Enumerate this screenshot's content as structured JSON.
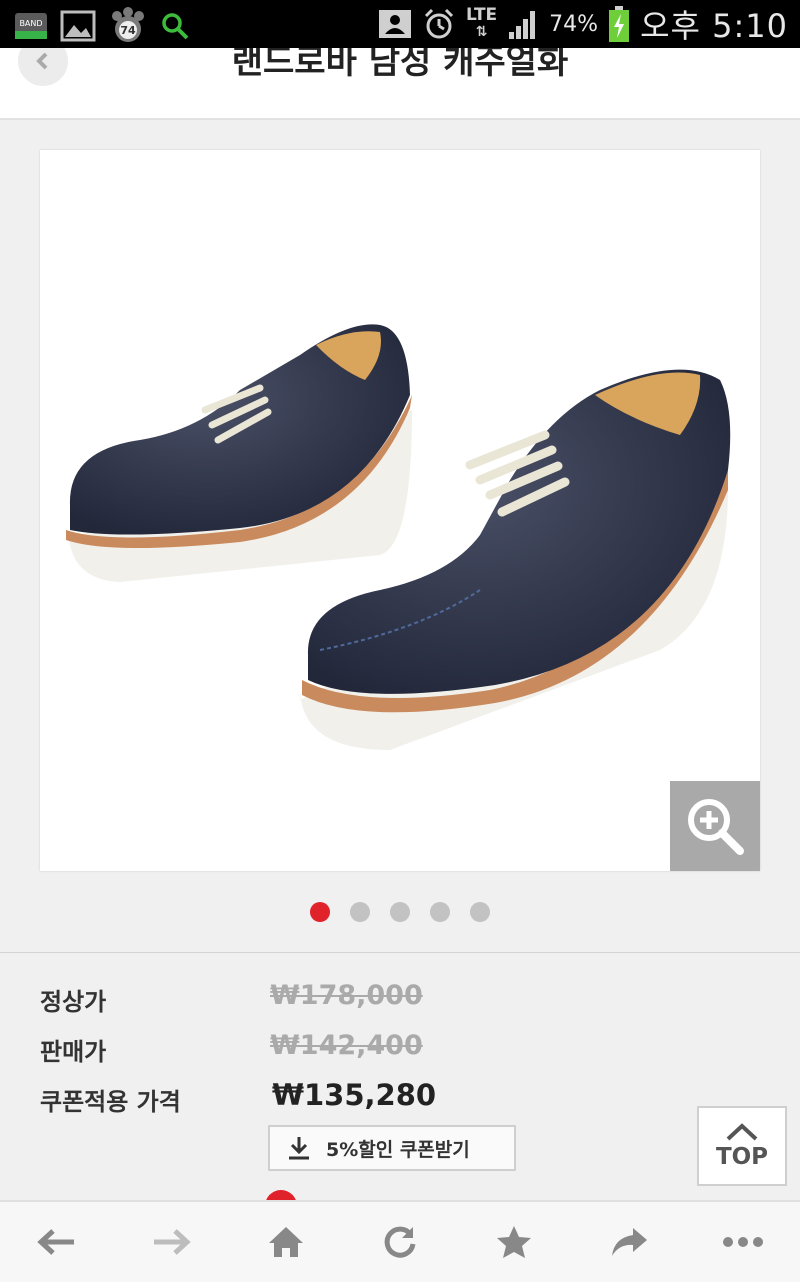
{
  "status_bar": {
    "clock": "오후 5:10",
    "battery_percent": "74%",
    "network": "LTE",
    "notification_badge": "74",
    "band_label": "BAND",
    "icons": [
      "band-icon",
      "gallery-icon",
      "paw-icon",
      "search-icon",
      "contact-icon",
      "alarm-icon",
      "lte-icon",
      "signal-icon",
      "battery-icon"
    ]
  },
  "header": {
    "title": "랜드로바 남성 캐주얼화",
    "back_icon": "chevron-left-icon"
  },
  "gallery": {
    "slide_count": 5,
    "active_index": 0,
    "zoom_icon": "zoom-in-icon"
  },
  "prices": {
    "regular_label": "정상가",
    "regular_value": "₩178,000",
    "sale_label": "판매가",
    "sale_value": "₩142,400",
    "coupon_label": "쿠폰적용 가격",
    "coupon_value": "₩135,280",
    "coupon_button": "5%할인 쿠폰받기"
  },
  "top_button": {
    "label": "TOP"
  },
  "bottom_nav": {
    "items": [
      "back-arrow-icon",
      "forward-arrow-icon",
      "home-icon",
      "refresh-icon",
      "star-icon",
      "share-icon",
      "more-icon"
    ]
  },
  "colors": {
    "accent_red": "#e0222b",
    "shoe_navy": "#2c3144",
    "sole_white": "#f1f0eb",
    "welt_tan": "#c98a5d"
  }
}
